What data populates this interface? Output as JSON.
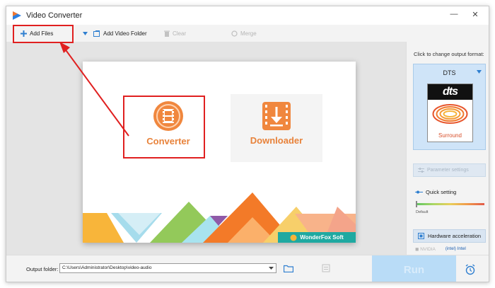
{
  "window": {
    "title": "Video Converter"
  },
  "toolbar": {
    "add_files": "Add Files",
    "add_video_folder": "Add Video Folder",
    "clear": "Clear",
    "merge": "Merge"
  },
  "main": {
    "converter_label": "Converter",
    "downloader_label": "Downloader",
    "brand": "WonderFox Soft"
  },
  "right_panel": {
    "hint": "Click to change output format:",
    "format": "DTS",
    "format_logo_text": "dts",
    "format_logo_subtext": "Surround",
    "parameter_settings": "Parameter settings",
    "quick_setting": "Quick setting",
    "default_label": "Default",
    "hardware_acceleration": "Hardware acceleration",
    "nvidia": "NVIDIA",
    "intel": "Intel"
  },
  "bottom": {
    "output_folder_label": "Output folder:",
    "output_folder_value": "C:\\Users\\Administrator\\Desktop\\video-audio",
    "run": "Run"
  },
  "colors": {
    "accent_orange": "#e8823a",
    "highlight_red": "#e02020",
    "format_box": "#cfe4f8",
    "brand_teal": "#1fa9a1"
  }
}
